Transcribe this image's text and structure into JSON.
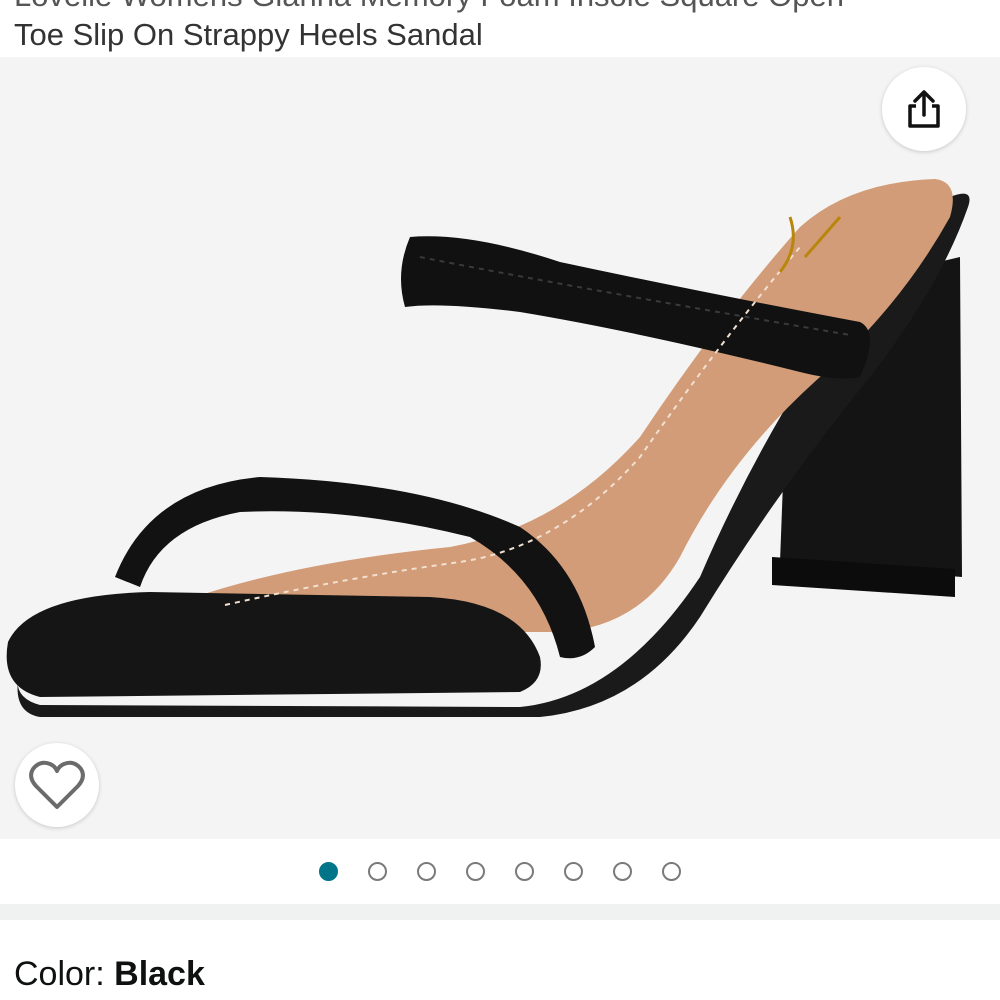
{
  "product": {
    "title_line_1": "Lovelle Womens Gianna Memory Foam Insole Square Open",
    "title_line_2": "Toe Slip On Strappy Heels Sandal"
  },
  "gallery": {
    "image_icon": "black-strappy-heel-sandal-image",
    "share_icon": "share-icon",
    "wishlist_icon": "heart-outline-icon",
    "page_count": 8,
    "active_page": 1,
    "accent_color": "#00758a"
  },
  "variation": {
    "label": "Color: ",
    "value": "Black"
  }
}
